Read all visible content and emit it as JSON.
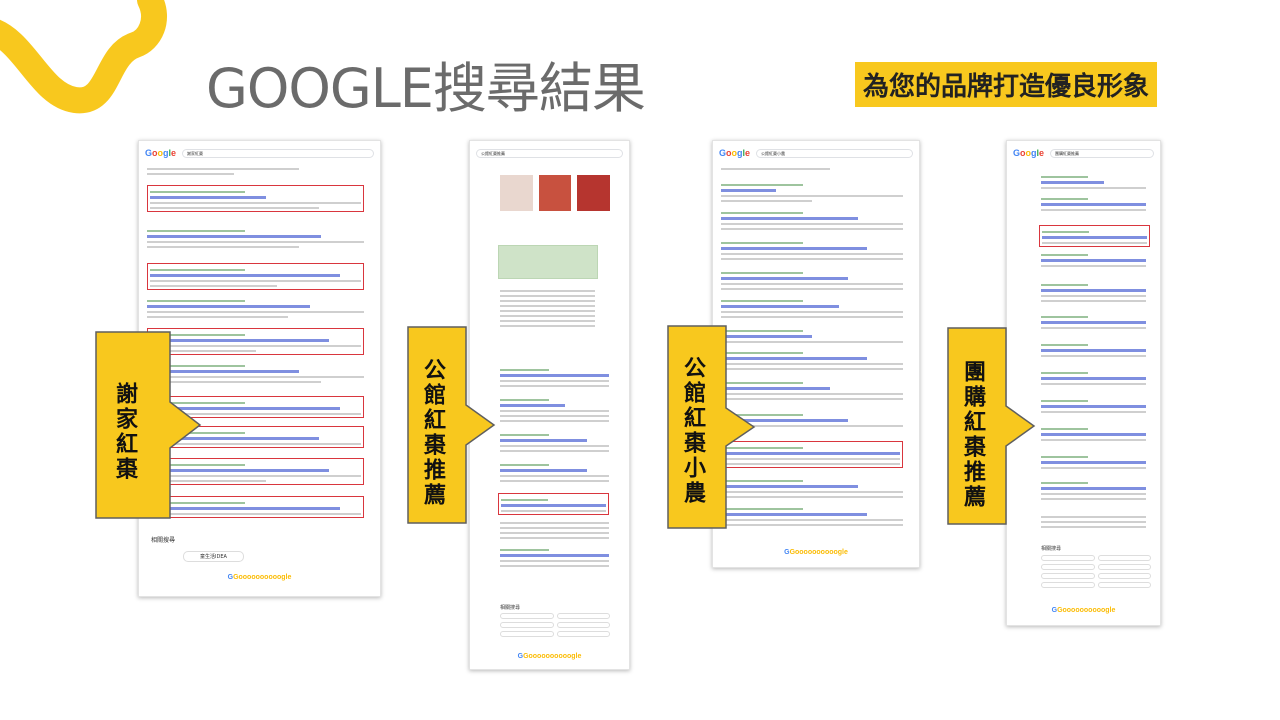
{
  "slide": {
    "title": "GOOGLE搜尋結果",
    "subtitle": "為您的品牌打造優良形象",
    "accent_color": "#f8c81e",
    "highlight_color": "#d9363e"
  },
  "panels": [
    {
      "label": "謝家紅棗",
      "query": "謝家紅棗",
      "related_title": "相關搜尋",
      "related_chip": "童生活IDEA"
    },
    {
      "label": "公館紅棗推薦",
      "query": "公館紅棗推薦",
      "related_title": "相關搜尋"
    },
    {
      "label": "公館紅棗小農",
      "query": "公館紅棗小農"
    },
    {
      "label": "團購紅棗推薦",
      "query": "團購紅棗推薦",
      "related_title": "相關搜尋"
    }
  ],
  "google": {
    "logo": "Google",
    "pager": "Goooooooooogle"
  },
  "icons": [
    "swirl-decoration",
    "arrow-right-icon",
    "search-icon",
    "mic-icon"
  ]
}
